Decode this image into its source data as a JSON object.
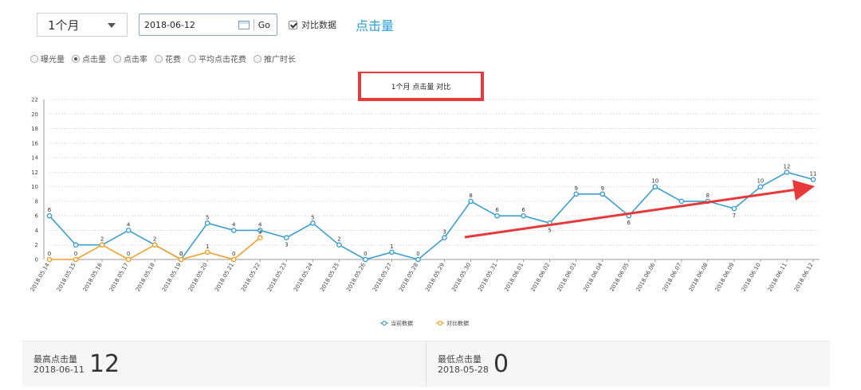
{
  "toolbar": {
    "period": "1个月",
    "date": "2018-06-12",
    "go_label": "Go",
    "compare_label": "对比数据",
    "compare_checked": true,
    "metric_title": "点击量"
  },
  "metric_options": [
    {
      "label": "曝光量",
      "selected": false
    },
    {
      "label": "点击量",
      "selected": true
    },
    {
      "label": "点击率",
      "selected": false
    },
    {
      "label": "花费",
      "selected": false
    },
    {
      "label": "平均点击花费",
      "selected": false
    },
    {
      "label": "推广时长",
      "selected": false
    }
  ],
  "chart_data": {
    "type": "line",
    "title": "1个月  点击量  对比",
    "ylim": [
      0,
      22
    ],
    "yticks": [
      0,
      2,
      4,
      6,
      8,
      10,
      12,
      14,
      16,
      18,
      20,
      22
    ],
    "grid": true,
    "legend_position": "bottom-center",
    "x": [
      "2018.05.14",
      "2018.05.15",
      "2018.05.16",
      "2018.05.17",
      "2018.05.18",
      "2018.05.19",
      "2018.05.20",
      "2018.05.21",
      "2018.05.22",
      "2018.05.23",
      "2018.05.24",
      "2018.05.25",
      "2018.05.26",
      "2018.05.27",
      "2018.05.28",
      "2018.05.29",
      "2018.05.30",
      "2018.05.31",
      "2018.06.01",
      "2018.06.02",
      "2018.06.03",
      "2018.06.04",
      "2018.06.05",
      "2018.06.06",
      "2018.06.07",
      "2018.06.08",
      "2018.06.09",
      "2018.06.10",
      "2018.06.11",
      "2018.06.12"
    ],
    "series": [
      {
        "name": "当前数据",
        "color": "#3a9fd0",
        "labeled": [
          true,
          false,
          false,
          true,
          false,
          true,
          true,
          true,
          true,
          true,
          true,
          true,
          true,
          true,
          true,
          true,
          true,
          true,
          true,
          true,
          true,
          true,
          true,
          true,
          false,
          true,
          true,
          true,
          true,
          true
        ],
        "values": [
          6,
          2,
          2,
          4,
          2,
          0,
          5,
          4,
          4,
          3,
          5,
          2,
          0,
          1,
          0,
          3,
          8,
          6,
          6,
          5,
          9,
          9,
          6,
          10,
          8,
          8,
          7,
          10,
          12,
          11
        ]
      },
      {
        "name": "对比数据",
        "color": "#f0a12a",
        "labeled": [
          true,
          true,
          true,
          true,
          true,
          true,
          true,
          true,
          true
        ],
        "values": [
          0,
          0,
          2,
          0,
          2,
          0,
          1,
          0,
          3
        ]
      }
    ],
    "highlight_box_color": "#e8383a",
    "trend_arrow_color": "#e8383a"
  },
  "stats": [
    {
      "label": "最高点击量",
      "date": "2018-06-11",
      "value": "12"
    },
    {
      "label": "最低点击量",
      "date": "2018-05-28",
      "value": "0"
    }
  ]
}
